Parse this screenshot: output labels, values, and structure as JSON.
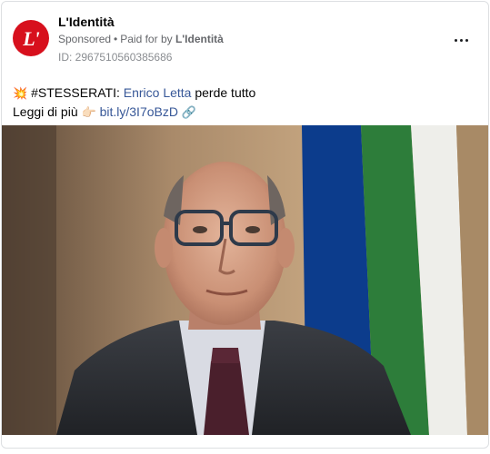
{
  "page": {
    "name": "L'Identità",
    "avatar_text": "L'",
    "sponsored_label": "Sponsored",
    "paid_for_prefix": "Paid for by",
    "payer": "L'Identità",
    "ad_id": "ID: 2967510560385686"
  },
  "post": {
    "line1_emoji": "💥",
    "hashtag": "#STESSERATI:",
    "name_link": "Enrico Letta",
    "line1_rest": "perde tutto",
    "line2_text": "Leggi di più",
    "pointing_emoji": "👉🏻",
    "url": "bit.ly/3I7oBzD",
    "trailing_emoji": "🔗"
  },
  "image": {
    "description_icon": "portrait-photo",
    "flag_colors": [
      "#0c3c8c",
      "#2d7d3a",
      "#f2f2f0",
      "#c8303a"
    ]
  },
  "icons": {
    "more": "more-options-icon"
  }
}
